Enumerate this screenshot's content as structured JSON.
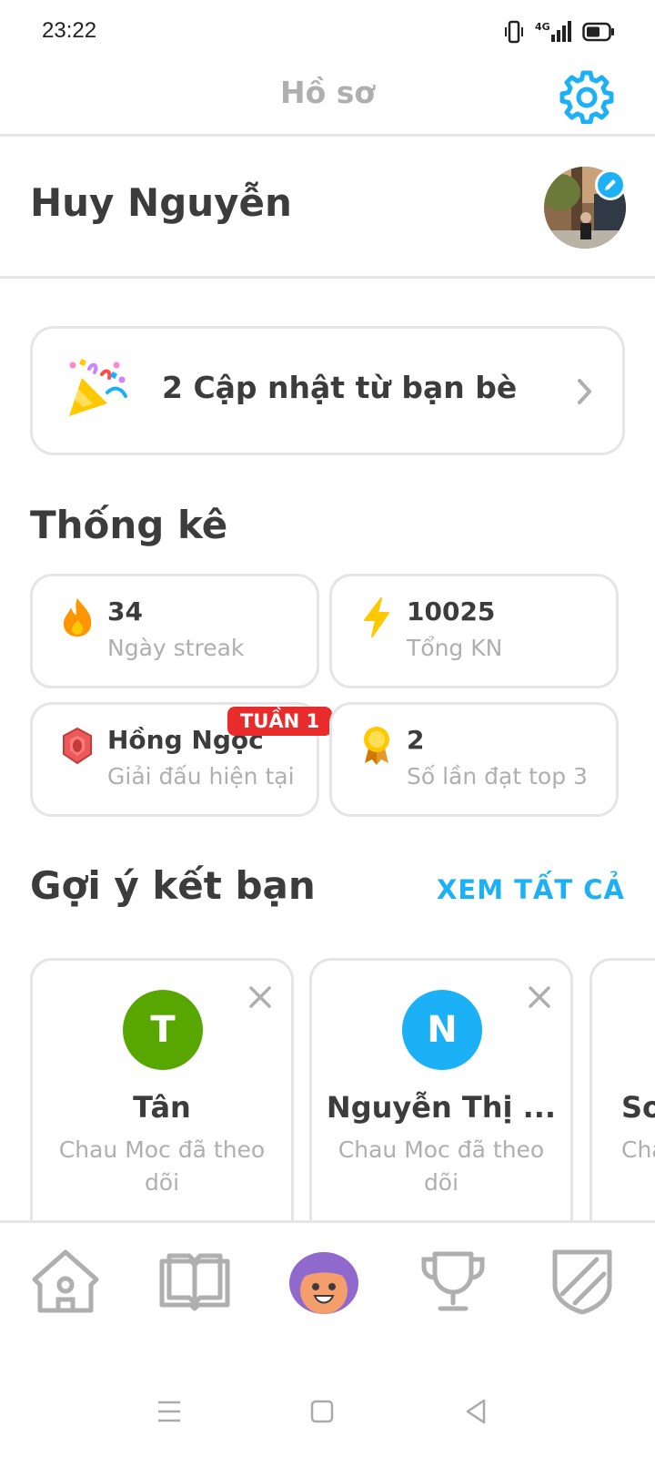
{
  "status_bar": {
    "time": "23:22",
    "icons": [
      "vibrate-icon",
      "signal-4g-icon",
      "battery-icon"
    ]
  },
  "header": {
    "title": "Hồ sơ",
    "settings_icon": "gear-icon"
  },
  "profile": {
    "name": "Huy Nguyễn",
    "avatar_icon": "profile-photo",
    "edit_icon": "pencil-icon"
  },
  "friend_updates": {
    "label": "2 Cập nhật từ bạn bè",
    "icon": "party-popper-icon"
  },
  "stats": {
    "title": "Thống kê",
    "items": [
      {
        "value": "34",
        "label": "Ngày streak",
        "icon": "flame-icon",
        "color": "#ff9600"
      },
      {
        "value": "10025",
        "label": "Tổng KN",
        "icon": "lightning-icon",
        "color": "#ffc800"
      },
      {
        "value": "Hồng Ngọc",
        "label": "Giải đấu hiện tại",
        "icon": "ruby-league-icon",
        "color": "#ea5a5a",
        "badge": "TUẦN 1"
      },
      {
        "value": "2",
        "label": "Số lần đạt top 3",
        "icon": "medal-icon",
        "color": "#ffc800"
      }
    ]
  },
  "suggestions": {
    "title": "Gợi ý kết bạn",
    "see_all": "XEM TẤT CẢ",
    "items": [
      {
        "initial": "T",
        "name": "Tân",
        "subtitle": "Chau Moc đã theo dõi",
        "color": "#58a700"
      },
      {
        "initial": "N",
        "name": "Nguyễn Thị ...",
        "subtitle": "Chau Moc đã theo dõi",
        "color": "#1cb0f6"
      },
      {
        "initial": "",
        "name": "So",
        "subtitle": "Cha",
        "color": "#ffffff"
      }
    ]
  },
  "bottom_nav": {
    "items": [
      "home-icon",
      "book-icon",
      "profile-character-icon",
      "trophy-icon",
      "shield-icon"
    ],
    "active_index": 2
  },
  "system_nav": [
    "menu-icon",
    "home-square-icon",
    "back-triangle-icon"
  ]
}
